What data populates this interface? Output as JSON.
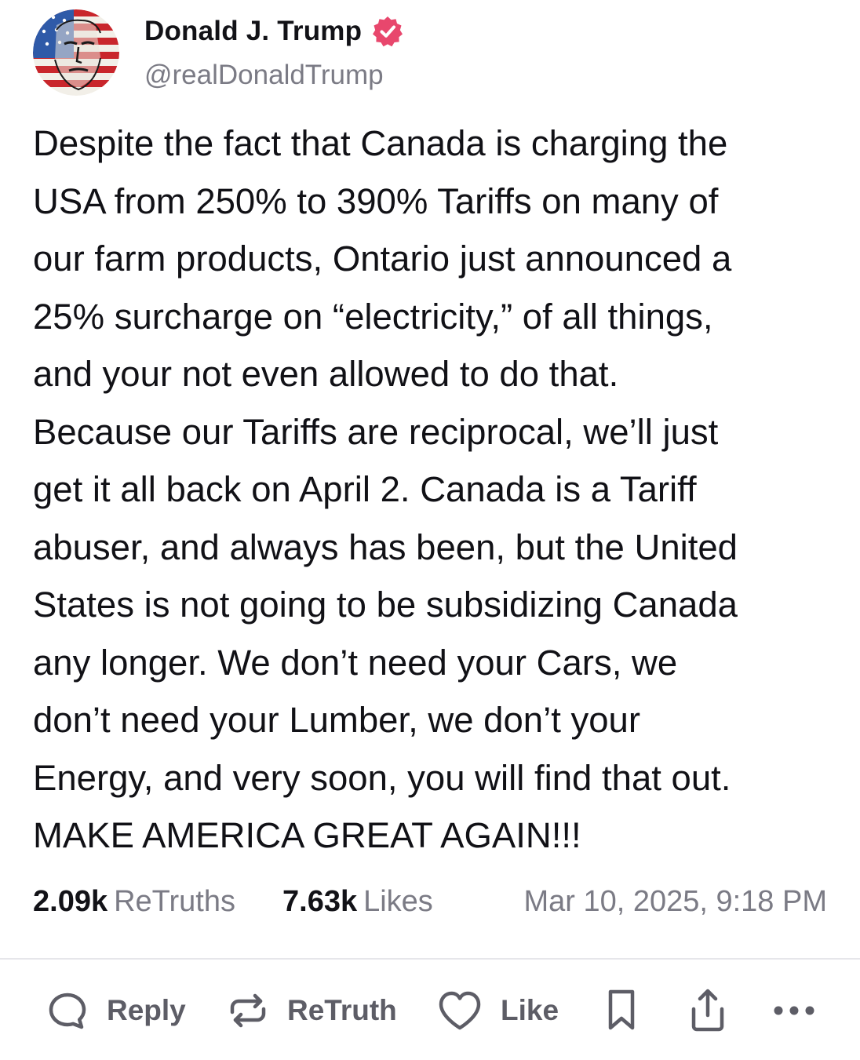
{
  "author": {
    "display_name": "Donald J. Trump",
    "handle": "@realDonaldTrump",
    "verified": true,
    "verified_color": "#e8476d"
  },
  "post": {
    "text": "Despite the fact that Canada is charging the\nUSA from 250% to 390% Tariffs on many of\nour farm products, Ontario just announced a\n25% surcharge on “electricity,” of all things,\nand your not even allowed to do that.\nBecause our Tariffs are reciprocal, we’ll just\nget it all back on April 2. Canada is a Tariff\nabuser, and always has been, but the United\nStates is not going to be subsidizing Canada\nany longer. We don’t need your Cars, we\ndon’t need your Lumber, we don’t your\nEnergy, and very soon, you will find that out.\nMAKE AMERICA GREAT AGAIN!!!"
  },
  "stats": {
    "retruths_count": "2.09k",
    "retruths_label": "ReTruths",
    "likes_count": "7.63k",
    "likes_label": "Likes",
    "timestamp": "Mar 10, 2025, 9:18 PM"
  },
  "actions": {
    "reply_label": "Reply",
    "retruth_label": "ReTruth",
    "like_label": "Like"
  },
  "icons": {
    "reply": "reply-bubble-icon",
    "retruth": "retruth-arrows-icon",
    "like": "heart-icon",
    "bookmark": "bookmark-icon",
    "share": "share-upload-icon",
    "more": "more-dots-icon",
    "verified": "verified-badge-icon"
  },
  "colors": {
    "text_primary": "#111116",
    "text_secondary": "#7b7b85",
    "icon_gray": "#5d5d66",
    "divider": "#e6e6ea"
  }
}
